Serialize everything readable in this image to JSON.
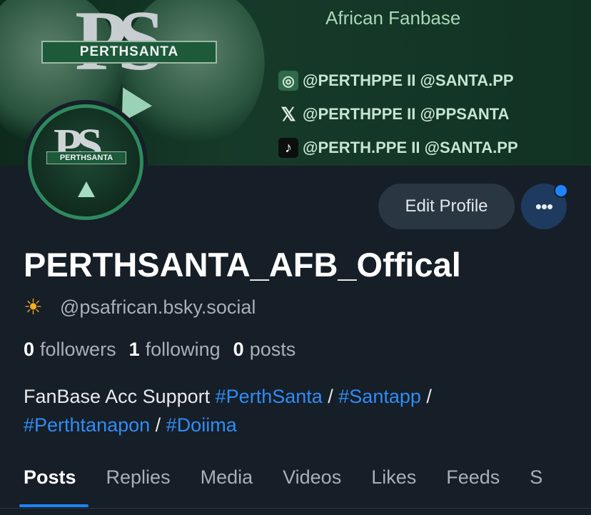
{
  "banner": {
    "ps_text": "PS",
    "plate_text": "PERTHSANTA",
    "fanbase_label": "African Fanbase",
    "socials": [
      {
        "icon": "instagram-icon",
        "text": "@PERTHPPE  II  @SANTA.PP"
      },
      {
        "icon": "x-icon",
        "text": "@PERTHPPE  II  @PPSANTA"
      },
      {
        "icon": "tiktok-icon",
        "text": "@PERTH.PPE  II  @SANTA.PP"
      }
    ],
    "colors": {
      "background": "#133324",
      "accent": "#a9d7b5"
    }
  },
  "avatar": {
    "ps_text": "PS",
    "plate_text": "PERTHSANTA"
  },
  "actions": {
    "edit_label": "Edit Profile",
    "more_label": "•••"
  },
  "profile": {
    "display_name": "PERTHSANTA_AFB_Offical",
    "handle": "@psafrican.bsky.social",
    "badge_icon": "sun-icon"
  },
  "stats": [
    {
      "count": "0",
      "label": "followers"
    },
    {
      "count": "1",
      "label": "following"
    },
    {
      "count": "0",
      "label": "posts"
    }
  ],
  "bio": {
    "line1_text": "FanBase Acc Support ",
    "tags": [
      "#PerthSanta",
      "#Santapp",
      "#Perthtanapon",
      "#Doiima"
    ],
    "separator": " / "
  },
  "tabs": [
    "Posts",
    "Replies",
    "Media",
    "Videos",
    "Likes",
    "Feeds",
    "S"
  ],
  "colors": {
    "page_bg": "#161e27",
    "link": "#2f8cf5",
    "muted": "#a6b0bb",
    "notification_dot": "#1d83ff"
  }
}
